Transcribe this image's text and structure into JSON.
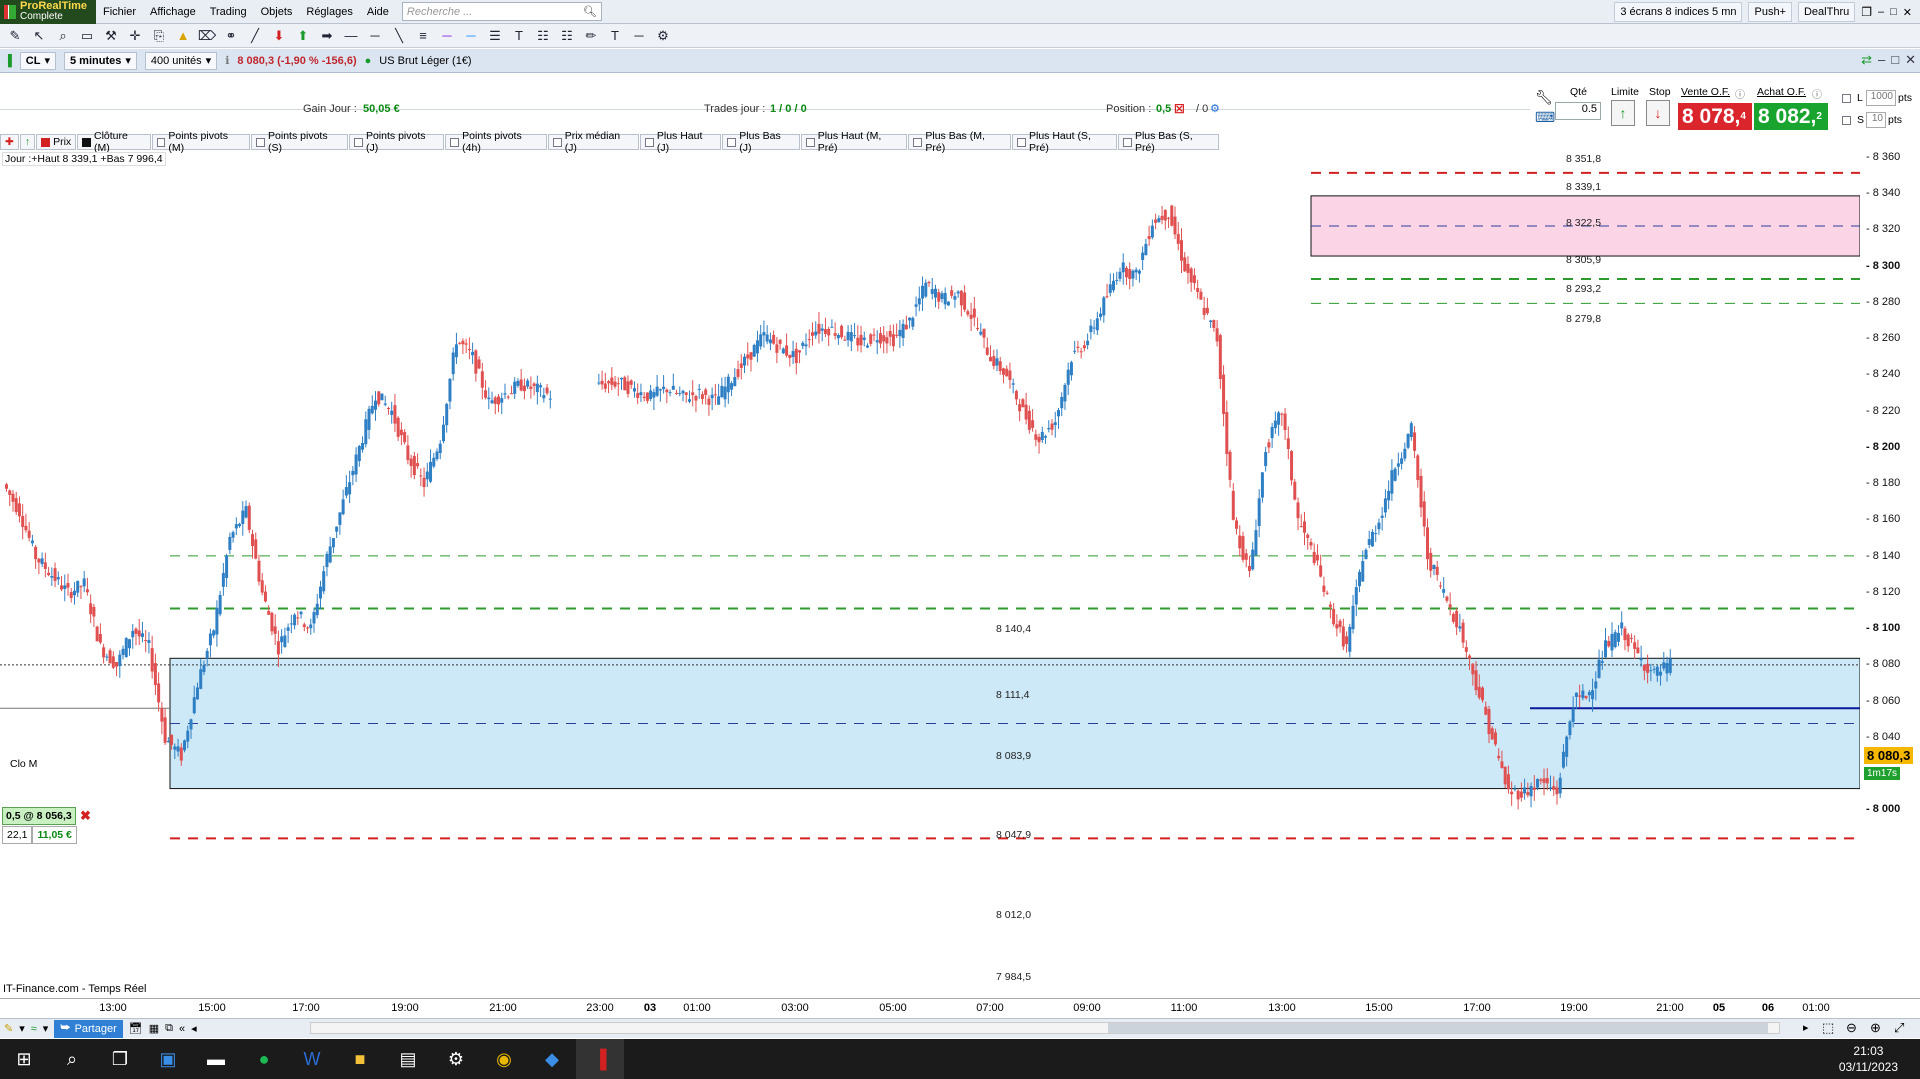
{
  "app": {
    "brand_top": "ProRealTime",
    "brand_bottom": "Complete"
  },
  "menu": {
    "items": [
      "Fichier",
      "Affichage",
      "Trading",
      "Objets",
      "Réglages",
      "Aide"
    ],
    "search_placeholder": "Recherche ..."
  },
  "right_menu": {
    "layout": "3 écrans 8 indices 5 mn",
    "push": "Push+",
    "dealthru": "DealThru"
  },
  "instrument": {
    "symbol": "CL",
    "timeframe": "5 minutes",
    "units": "400 unités",
    "quote": "8 080,3 (-1,90 % -156,6)",
    "name": "US Brut Léger (1€)"
  },
  "info": {
    "gain_label": "Gain Jour :",
    "gain_value": "50,05 €",
    "trades_label": "Trades jour :",
    "trades_value": "1 / 0 / 0",
    "position_label": "Position :",
    "position_value": "0,5",
    "position_after": "/ 0"
  },
  "order": {
    "qty_label": "Qté",
    "qty": "0.5",
    "limit_label": "Limite",
    "stop_label": "Stop",
    "sell_label": "Vente O.F.",
    "buy_label": "Achat O.F.",
    "sell_price": "8 078,",
    "sell_sup": "4",
    "buy_price": "8 082,",
    "buy_sup": "2",
    "l_label": "L",
    "l_value": "1000",
    "s_label": "S",
    "s_value": "10",
    "pts": "pts"
  },
  "indicators": [
    {
      "label": "Prix",
      "color": "#d32020"
    },
    {
      "label": "Clôture (M)",
      "color": "#111111"
    },
    {
      "label": "Points pivots (M)",
      "color": ""
    },
    {
      "label": "Points pivots (S)",
      "color": ""
    },
    {
      "label": "Points pivots (J)",
      "color": ""
    },
    {
      "label": "Points pivots (4h)",
      "color": ""
    },
    {
      "label": "Prix médian (J)",
      "color": ""
    },
    {
      "label": "Plus Haut (J)",
      "color": ""
    },
    {
      "label": "Plus Bas (J)",
      "color": ""
    },
    {
      "label": "Plus Haut (M, Pré)",
      "color": ""
    },
    {
      "label": "Plus Bas (M, Pré)",
      "color": ""
    },
    {
      "label": "Plus Haut (S, Pré)",
      "color": ""
    },
    {
      "label": "Plus Bas (S, Pré)",
      "color": ""
    }
  ],
  "day_hilo": "Jour :+Haut 8 339,1 +Bas 7 996,4",
  "levels": {
    "l8351": "8 351,8",
    "l8339": "8 339,1",
    "l8322": "8 322,5",
    "l8305": "8 305,9",
    "l8293": "8 293,2",
    "l8279": "8 279,8",
    "l8140": "8 140,4",
    "l8111": "8 111,4",
    "l8083": "8 083,9",
    "l8047": "8 047,9",
    "l8012": "8 012,0",
    "l7984": "7 984,5"
  },
  "y_ticks": [
    "8 360",
    "8 340",
    "8 320",
    "8 300",
    "8 280",
    "8 260",
    "8 240",
    "8 220",
    "8 200",
    "8 180",
    "8 160",
    "8 140",
    "8 120",
    "8 100",
    "8 080",
    "8 060",
    "8 040",
    "8 020",
    "8 000"
  ],
  "y_bold": [
    "8 300",
    "8 200",
    "8 100",
    "8 000"
  ],
  "price_tag": "8 080,3",
  "time_tag": "1m17s",
  "clo_label": "Clo M",
  "position_box": {
    "text": "0,5 @ 8 056,3",
    "qty": "22,1",
    "pnl": "11,05 €"
  },
  "source": "IT-Finance.com - Temps Réel",
  "x_labels": [
    "13:00",
    "15:00",
    "17:00",
    "19:00",
    "21:00",
    "23:00",
    "03",
    "01:00",
    "03:00",
    "05:00",
    "07:00",
    "09:00",
    "11:00",
    "13:00",
    "15:00",
    "17:00",
    "19:00",
    "21:00",
    "05",
    "06",
    "01:00"
  ],
  "bottom": {
    "share": "Partager"
  },
  "clock": {
    "time": "21:03",
    "date": "03/11/2023"
  },
  "colors": {
    "up": "#2e7fc4",
    "down": "#e05050",
    "pink_zone": "#fbd4e6",
    "blue_zone": "#cde9f8"
  },
  "chart_data": {
    "type": "line",
    "title": "",
    "ylim": [
      7980,
      8365
    ],
    "series": [
      {
        "values": [
          8180,
          8165,
          8140,
          8130,
          8120,
          8125,
          8090,
          8080,
          8100,
          8090,
          8040,
          8030,
          8070,
          8100,
          8150,
          8165,
          8120,
          8090,
          8110,
          8100,
          8140,
          8170,
          8200,
          8230,
          8220,
          8195,
          8180,
          8205,
          8260,
          8250,
          8225,
          8230,
          8235,
          8232,
          8228,
          8233,
          8231,
          8235,
          8236,
          8232,
          8228,
          8233,
          8228,
          8230,
          8226,
          8238,
          8250,
          8262,
          8255,
          8250,
          8265,
          8266,
          8262,
          8258,
          8262,
          8260,
          8270,
          8290,
          8282,
          8285,
          8270,
          8250,
          8240,
          8220,
          8205,
          8215,
          8250,
          8260,
          8280,
          8300,
          8295,
          8325,
          8330,
          8300,
          8280,
          8260,
          8160,
          8130,
          8200,
          8220,
          8160,
          8140,
          8110,
          8090,
          8140,
          8160,
          8190,
          8210,
          8140,
          8120,
          8100,
          8070,
          8040,
          8010,
          8010,
          8016,
          8010,
          8060,
          8065,
          8090,
          8100,
          8085,
          8075,
          8080
        ]
      }
    ],
    "levels": [
      8351.8,
      8339.1,
      8322.5,
      8305.9,
      8293.2,
      8279.8,
      8140.4,
      8111.4,
      8083.9,
      8047.9,
      8012.0,
      7984.5
    ]
  }
}
